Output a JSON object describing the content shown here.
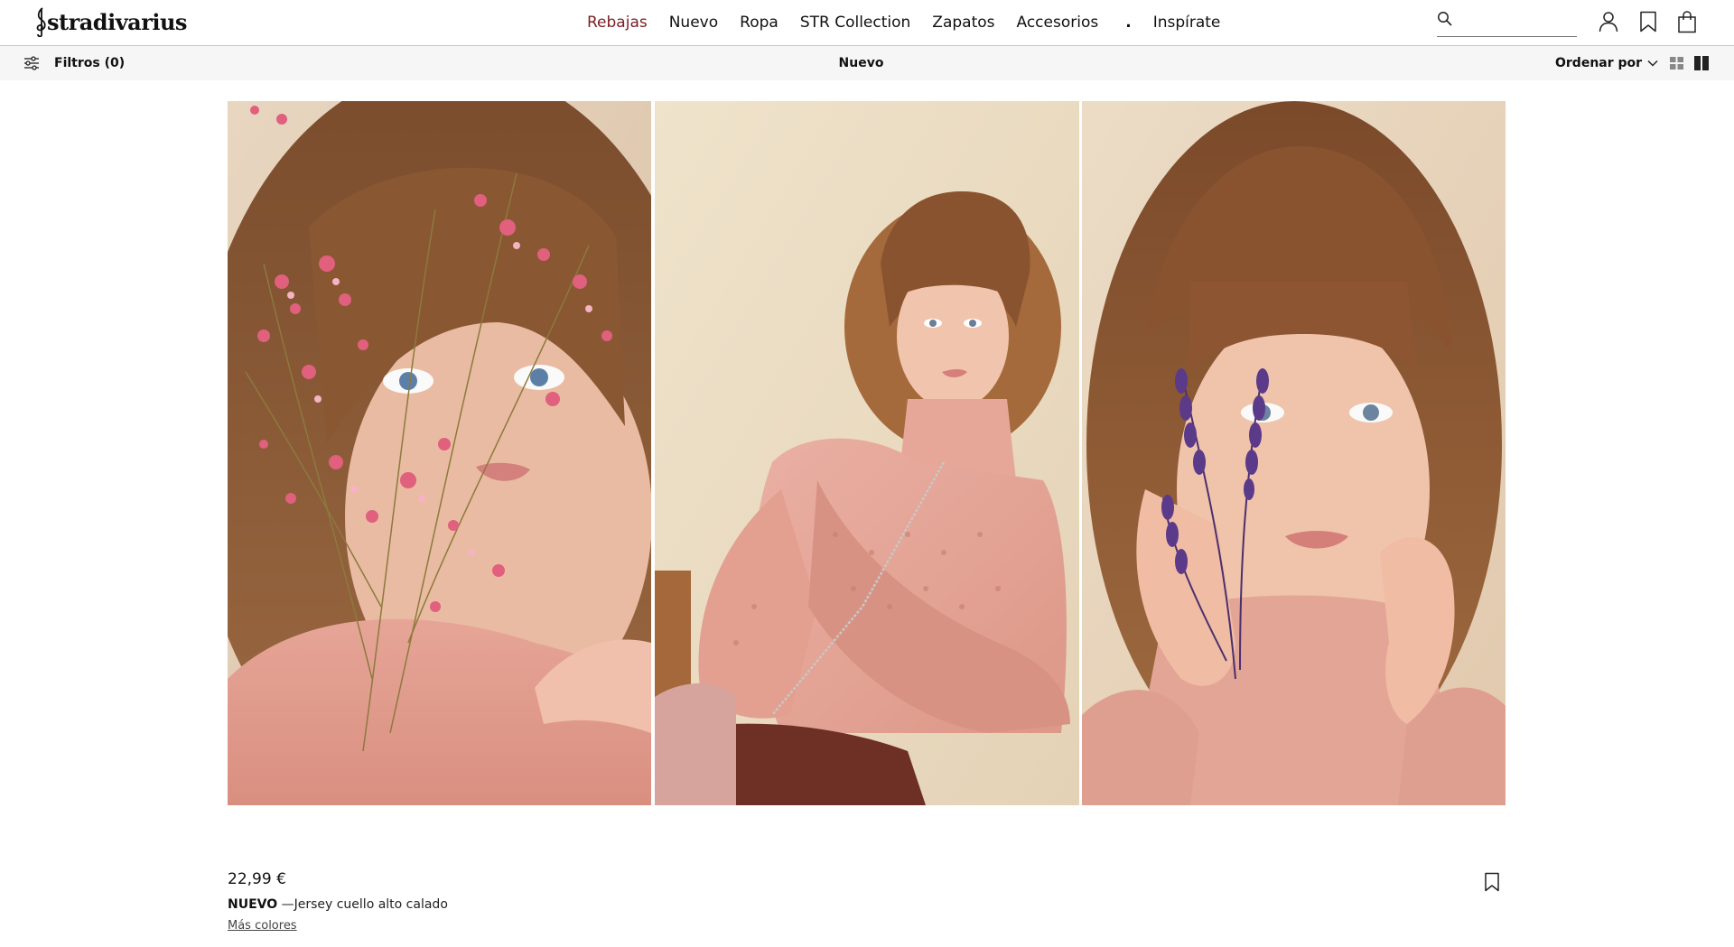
{
  "header": {
    "logo": "stradivarius",
    "nav": [
      {
        "label": "Rebajas"
      },
      {
        "label": "Nuevo"
      },
      {
        "label": "Ropa"
      },
      {
        "label": "STR Collection"
      },
      {
        "label": "Zapatos"
      },
      {
        "label": "Accesorios"
      },
      {
        "label": "Inspírate"
      }
    ],
    "nav_separator": ".",
    "search": {
      "value": "",
      "placeholder": ""
    },
    "icons": [
      "search-icon",
      "user-icon",
      "bookmark-icon",
      "shopping-bag-icon"
    ],
    "colors": {
      "sale": "#7a1e24",
      "text": "#111111"
    }
  },
  "filter_bar": {
    "filters_label": "Filtros (0)",
    "title": "Nuevo",
    "sort_label": "Ordenar por",
    "icons": [
      "filter-sliders-icon",
      "chevron-down-icon",
      "grid-view-icon",
      "column-view-icon"
    ],
    "background": "#f6f6f6"
  },
  "product": {
    "images": [
      "model-with-pink-flowers",
      "model-sitting-pink-sweater",
      "model-with-lavender"
    ],
    "price": "22,99 €",
    "tag": "NUEVO",
    "separator": " —",
    "name": "Jersey cuello alto calado",
    "more_colors": "Más colores",
    "icons": [
      "bookmark-icon"
    ]
  }
}
